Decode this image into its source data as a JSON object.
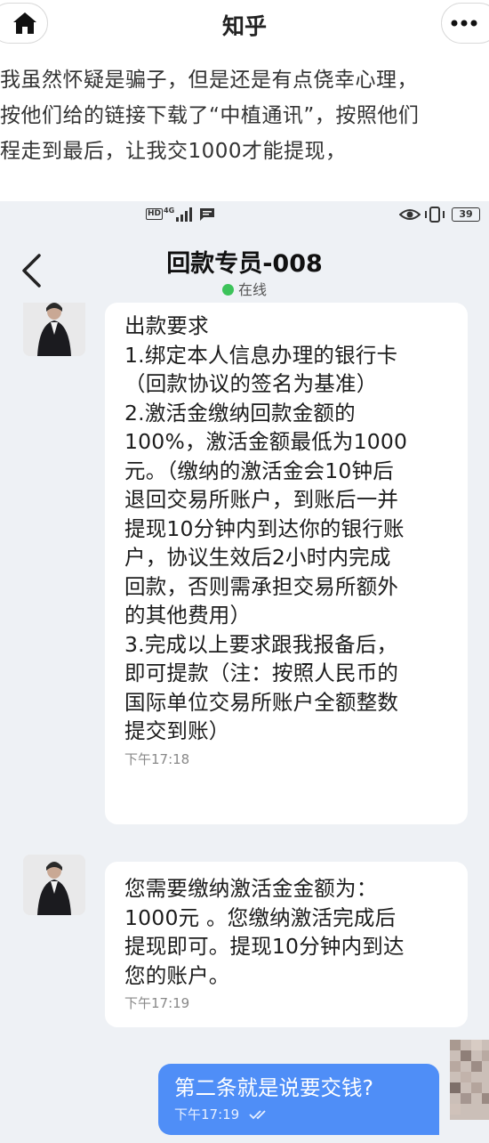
{
  "app": {
    "title": "知乎",
    "home_icon": "home-icon",
    "more_icon": "more-dots-icon"
  },
  "excerpt": {
    "lines": [
      "我虽然怀疑是骗子，但是还是有点侥幸心理，",
      "按他们给的链接下载了“中植通讯”，按照他们",
      "程走到最后，让我交1000才能提现，"
    ]
  },
  "statusbar": {
    "hd": "HD",
    "network": "4G",
    "battery": "39"
  },
  "chat": {
    "contact_name": "回款专员-008",
    "status": "在线",
    "online_color": "#3cc35a",
    "messages": [
      {
        "text": "出款要求\n1.绑定本人信息办理的银行卡\n（回款协议的签名为基准）\n2.激活金缴纳回款金额的\n100%，激活金额最低为1000\n元。（缴纳的激活金会10钟后\n退回交易所账户，到账后一并\n提现10分钟内到达你的银行账\n户，协议生效后2小时内完成\n回款，否则需承担交易所额外\n的其他费用）\n3.完成以上要求跟我报备后，\n即可提款（注：按照人民币的\n国际单位交易所账户全额整数\n提交到账）",
        "time": "下午17:18"
      },
      {
        "text": "您需要缴纳激活金金额为：\n1000元 。您缴纳激活完成后\n提现即可。提现10分钟内到达\n您的账户。",
        "time": "下午17:19"
      }
    ],
    "sent": {
      "text": "第二条就是说要交钱?",
      "time": "下午17:19",
      "bubble_color": "#4f8ef7"
    }
  }
}
